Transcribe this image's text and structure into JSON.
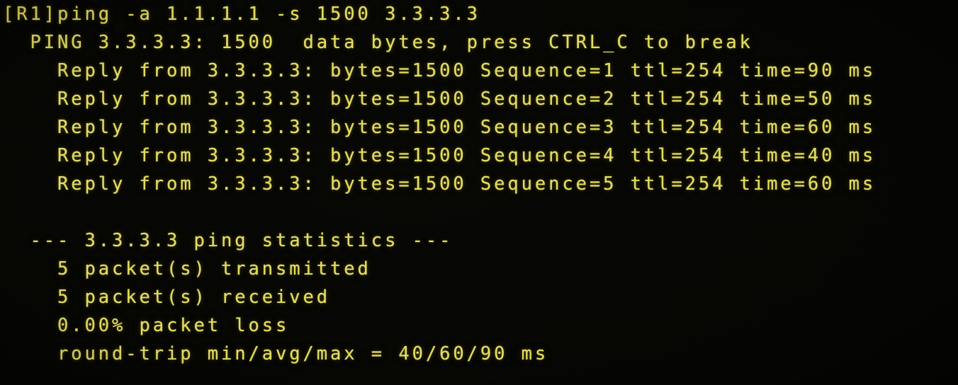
{
  "terminal": {
    "device_prompt": "[R1]",
    "command": "ping -a 1.1.1.1 -s 1500 3.3.3.3",
    "background_color": "#000000",
    "text_color": "#e3dc62",
    "lines": [
      "[R1]ping -a 1.1.1.1 -s 1500 3.3.3.3",
      "  PING 3.3.3.3: 1500  data bytes, press CTRL_C to break",
      "    Reply from 3.3.3.3: bytes=1500 Sequence=1 ttl=254 time=90 ms",
      "    Reply from 3.3.3.3: bytes=1500 Sequence=2 ttl=254 time=50 ms",
      "    Reply from 3.3.3.3: bytes=1500 Sequence=3 ttl=254 time=60 ms",
      "    Reply from 3.3.3.3: bytes=1500 Sequence=4 ttl=254 time=40 ms",
      "    Reply from 3.3.3.3: bytes=1500 Sequence=5 ttl=254 time=60 ms",
      "",
      "  --- 3.3.3.3 ping statistics ---",
      "    5 packet(s) transmitted",
      "    5 packet(s) received",
      "    0.00% packet loss",
      "    round-trip min/avg/max = 40/60/90 ms"
    ],
    "command_line": {
      "prompt": "[R1]",
      "program": "ping",
      "flag_source": "-a",
      "source_address": "1.1.1.1",
      "flag_size": "-s",
      "packet_size": "1500",
      "destination_address": "3.3.3.3"
    },
    "ping_header": {
      "label": "PING",
      "target": "3.3.3.3",
      "data_bytes": "1500",
      "data_bytes_label": "data bytes",
      "break_hint": "press CTRL_C to break"
    },
    "replies": [
      {
        "source": "3.3.3.3",
        "bytes": "1500",
        "sequence": "1",
        "ttl": "254",
        "time": "90",
        "unit": "ms"
      },
      {
        "source": "3.3.3.3",
        "bytes": "1500",
        "sequence": "2",
        "ttl": "254",
        "time": "50",
        "unit": "ms"
      },
      {
        "source": "3.3.3.3",
        "bytes": "1500",
        "sequence": "3",
        "ttl": "254",
        "time": "60",
        "unit": "ms"
      },
      {
        "source": "3.3.3.3",
        "bytes": "1500",
        "sequence": "4",
        "ttl": "254",
        "time": "40",
        "unit": "ms"
      },
      {
        "source": "3.3.3.3",
        "bytes": "1500",
        "sequence": "5",
        "ttl": "254",
        "time": "60",
        "unit": "ms"
      }
    ],
    "statistics": {
      "header": "--- 3.3.3.3 ping statistics ---",
      "target": "3.3.3.3",
      "transmitted": "5 packet(s) transmitted",
      "received": "5 packet(s) received",
      "loss": "0.00% packet loss",
      "round_trip": "round-trip min/avg/max = 40/60/90 ms",
      "min_ms": "40",
      "avg_ms": "60",
      "max_ms": "90",
      "loss_percent": "0.00%",
      "packets_transmitted": "5",
      "packets_received": "5"
    }
  }
}
